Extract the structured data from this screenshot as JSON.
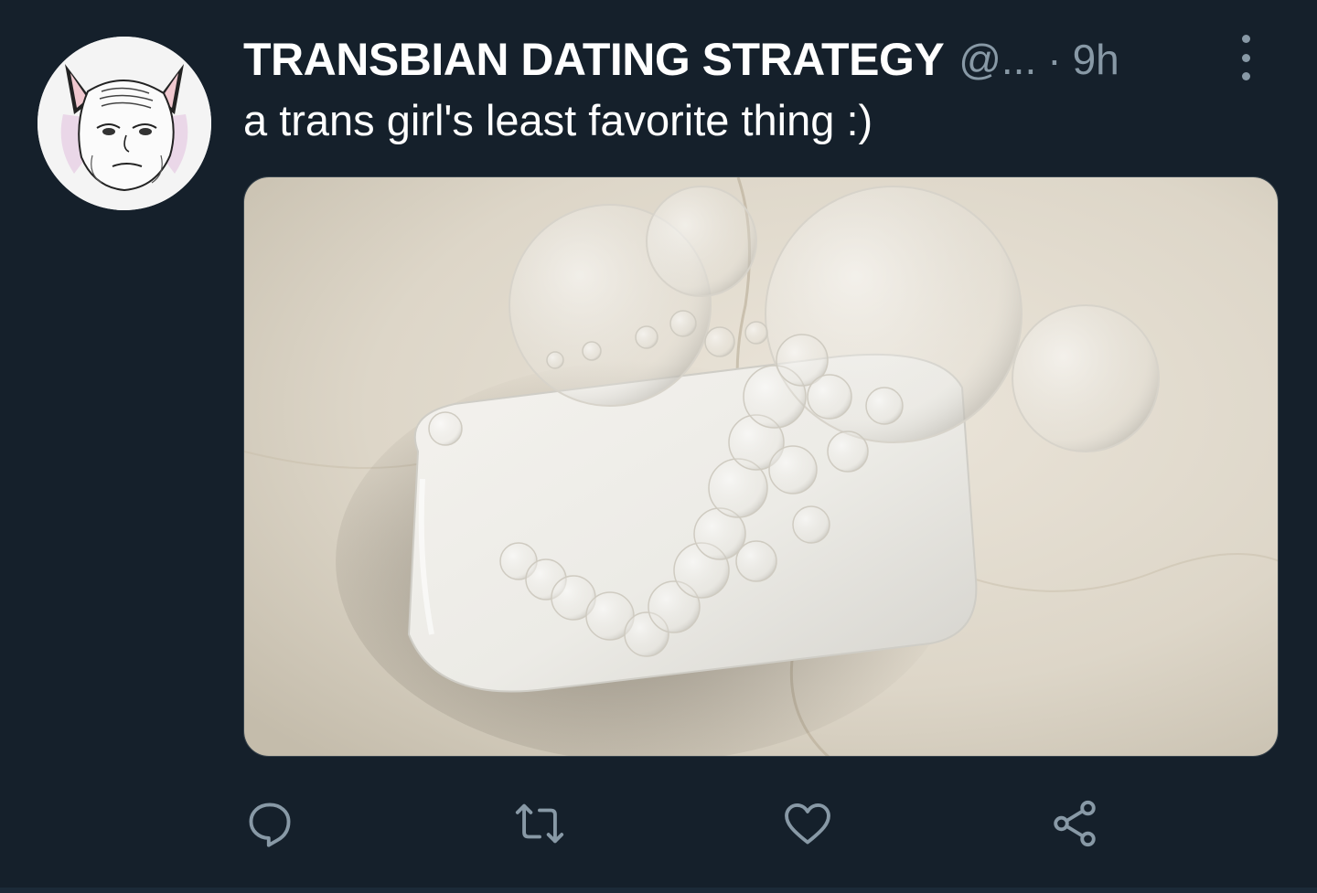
{
  "tweet": {
    "display_name": "TRANSBIAN DATING STRATEGY",
    "handle": "@...",
    "separator": "·",
    "time": "9h",
    "text": "a trans girl's least favorite thing :)",
    "avatar_icon": "wojak-cat-ears-avatar",
    "media_icon": "soap-bar-photo"
  },
  "actions": [
    {
      "name": "reply",
      "icon": "reply-icon"
    },
    {
      "name": "retweet",
      "icon": "retweet-icon"
    },
    {
      "name": "like",
      "icon": "heart-icon"
    },
    {
      "name": "share",
      "icon": "share-icon"
    }
  ],
  "colors": {
    "background": "#15202b",
    "secondary_text": "#8899a6",
    "primary_text": "#ffffff"
  }
}
